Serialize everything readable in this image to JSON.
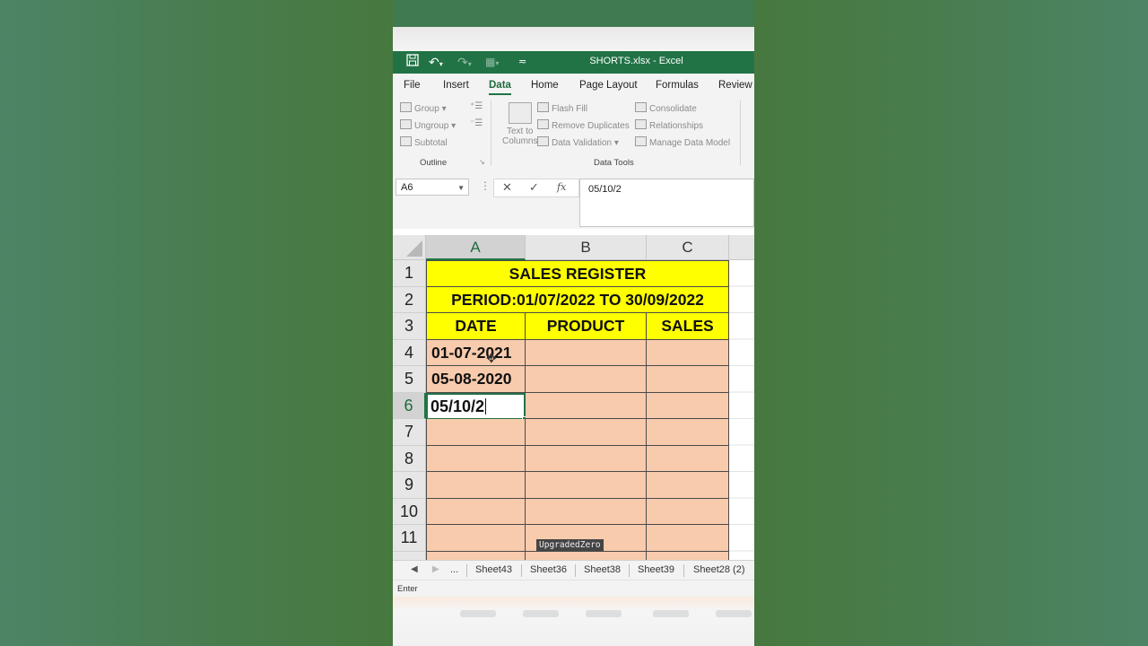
{
  "app": {
    "filename": "SHORTS.xlsx",
    "separator": "-",
    "app_name": "Excel",
    "accent": "#217346"
  },
  "quick_access": {
    "save_icon": "save-icon",
    "undo_icon": "undo-icon",
    "redo_icon": "redo-icon",
    "customize_icon": "customize-icon"
  },
  "menu": {
    "tabs": [
      "File",
      "Insert",
      "Data",
      "Home",
      "Page Layout",
      "Formulas",
      "Review"
    ],
    "active": "Data"
  },
  "ribbon": {
    "outline": {
      "group_label": "Outline",
      "items": [
        "Group",
        "Ungroup",
        "Subtotal"
      ]
    },
    "data_tools": {
      "group_label": "Data Tools",
      "text_to_columns": [
        "Text to",
        "Columns"
      ],
      "items": [
        "Flash Fill",
        "Remove Duplicates",
        "Data Validation",
        "Consolidate",
        "Relationships",
        "Manage Data Model"
      ]
    }
  },
  "formula_bar": {
    "name_box": "A6",
    "cancel": "✕",
    "enter": "✓",
    "fx": "fx",
    "value": "05/10/2"
  },
  "sheet": {
    "columns": [
      "A",
      "B",
      "C"
    ],
    "selected_column": "A",
    "rows": [
      "1",
      "2",
      "3",
      "4",
      "5",
      "6",
      "7",
      "8",
      "9",
      "10",
      "11"
    ],
    "selected_row": "6",
    "title": "SALES REGISTER",
    "period": "PERIOD:01/07/2022 TO 30/09/2022",
    "headers": [
      "DATE",
      "PRODUCT",
      "SALES"
    ],
    "dates": [
      "01-07-2021",
      "05-08-2020",
      "05/10/2"
    ],
    "colors": {
      "yellow": "#ffff00",
      "peach": "#f8cbad"
    }
  },
  "sheet_tabs": {
    "more": "...",
    "tabs": [
      "Sheet43",
      "Sheet36",
      "Sheet38",
      "Sheet39",
      "Sheet28 (2)"
    ]
  },
  "status": {
    "mode": "Enter"
  },
  "watermark": "UpgradedZero"
}
